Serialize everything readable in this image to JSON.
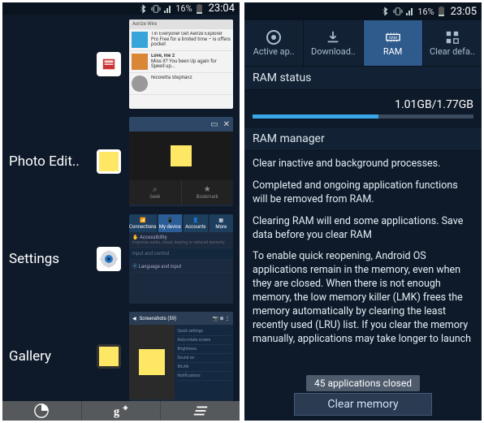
{
  "left": {
    "status": {
      "battery": "16%",
      "time": "23:04"
    },
    "recents": [
      {
        "label": "",
        "icon": "news",
        "thumb": "news"
      },
      {
        "label": "Photo Edit..",
        "icon": "photo",
        "thumb": "photo"
      },
      {
        "label": "Settings",
        "icon": "gear",
        "thumb": "settings"
      },
      {
        "label": "Gallery",
        "icon": "gallery",
        "thumb": "gallery"
      }
    ],
    "thumbs": {
      "news": {
        "title": "Aorize Wire",
        "item1": "Tin Everyone! Get Aerize Explorer Pro Free for a limited time – is offers pocket",
        "item2": "Love, me 2",
        "item2_sub": "Miss it? You been Up again for Speed up...",
        "item3": "Nicoletta Stephanz"
      },
      "photo": {
        "tab1": "Seek",
        "tab2": "Bookmark"
      },
      "settings": {
        "tabs": [
          "Connections",
          "My device",
          "Accounts",
          "More"
        ],
        "row1": "Accessibility",
        "row1_sub": "Improves audio, visual, hearing or reduced dexterity",
        "sect": "Input and control",
        "row2": "Language and input"
      },
      "gallery": {
        "title": "Screenshots (59)",
        "side": [
          "Quick settings",
          "Auto-rotate screen",
          "Brightness",
          "Sound on",
          "WLAN",
          "Notifications"
        ]
      }
    },
    "bottom": {
      "pie_label": "task-manager",
      "google_label": "google",
      "clear_label": "clear-all"
    }
  },
  "right": {
    "status": {
      "battery": "16%",
      "time": "23:05"
    },
    "tabs": [
      {
        "label": "Active ap..",
        "icon": "circle"
      },
      {
        "label": "Download..",
        "icon": "download"
      },
      {
        "label": "RAM",
        "icon": "ram",
        "active": true
      },
      {
        "label": "Clear defa..",
        "icon": "grid"
      }
    ],
    "ram_status": {
      "header": "RAM status",
      "value": "1.01GB/1.77GB",
      "percent": 57
    },
    "ram_manager": {
      "header": "RAM manager",
      "p1": "Clear inactive and background processes.",
      "p2": "Completed and ongoing application functions will be removed from RAM.",
      "p3": "Clearing RAM will end some applications. Save data before you clear RAM",
      "p4": "To enable quick reopening, Android OS applications remain in the memory, even when they are closed. When there is not enough memory, the low memory killer (LMK) frees the memory automatically by clearing the least recently used (LRU) list. If you clear the memory manually, applications may take longer to launch"
    },
    "toast": "45 applications closed",
    "clear_btn": "Clear memory"
  }
}
